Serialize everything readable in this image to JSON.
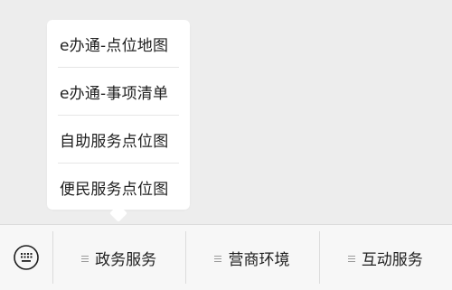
{
  "popup": {
    "items": [
      {
        "label": "e办通-点位地图"
      },
      {
        "label": "e办通-事项清单"
      },
      {
        "label": "自助服务点位图"
      },
      {
        "label": "便民服务点位图"
      }
    ]
  },
  "bottom_bar": {
    "keyboard_icon": "keyboard-icon",
    "tabs": [
      {
        "label": "政务服务",
        "icon": "menu-lines-icon"
      },
      {
        "label": "营商环境",
        "icon": "menu-lines-icon"
      },
      {
        "label": "互动服务",
        "icon": "menu-lines-icon"
      }
    ]
  },
  "colors": {
    "background": "#ededed",
    "popup_bg": "#ffffff",
    "bar_bg": "#f7f7f7",
    "text": "#1f1f1f",
    "divider": "#dcdcdc"
  }
}
